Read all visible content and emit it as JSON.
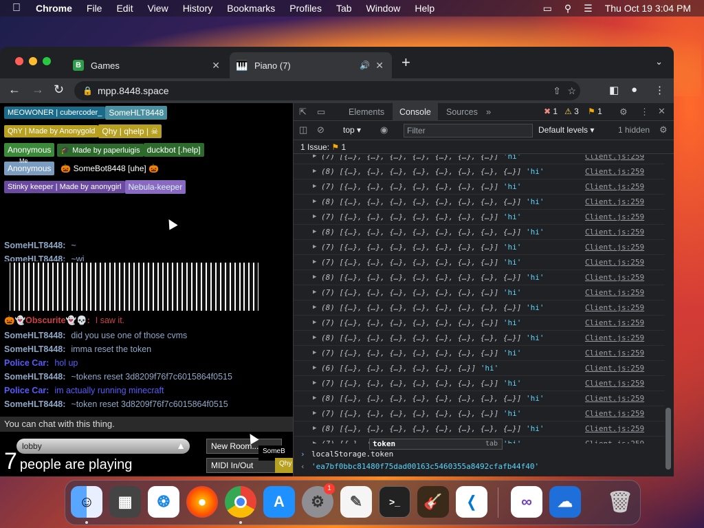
{
  "menubar": {
    "apple": "",
    "app": "Chrome",
    "items": [
      "File",
      "Edit",
      "View",
      "History",
      "Bookmarks",
      "Profiles",
      "Tab",
      "Window",
      "Help"
    ],
    "datetime": "Thu Oct 19  3:04 PM"
  },
  "browser": {
    "tabs": [
      {
        "title": "Games",
        "favicon": "B"
      },
      {
        "title": "Piano (7)",
        "favicon": "piano"
      }
    ],
    "url": "mpp.8448.space"
  },
  "page": {
    "users": [
      {
        "tag": "MEOWONER | cubercoder_",
        "name": "SomeHLT8448"
      },
      {
        "tag": "QhY | Made by Anonygold",
        "name": "Qhy | qhelp | ☠"
      },
      {
        "tag": "Anonymous",
        "name": "🎓 Made by paperluigis",
        "name2": "duckbot [.help]"
      },
      {
        "tag": "Anonymous",
        "me": "Me",
        "name": "🎃 SomeBot8448 [uhe] 🎃"
      },
      {
        "tag": "Stinky keeper | Made by anonygirl",
        "name": "Nebula-keeper"
      }
    ],
    "chat": [
      {
        "who": "SomeHLT8448:",
        "msg": "~"
      },
      {
        "who": "SomeHLT8448:",
        "msg": "~wi"
      },
      {
        "who": "🎃👻Obscurite👻💀:",
        "msg": "I saw it."
      },
      {
        "who": "SomeHLT8448:",
        "msg": "did you use one of those cvms"
      },
      {
        "who": "SomeHLT8448:",
        "msg": "imma reset the token"
      },
      {
        "who": "Police Car:",
        "msg": "hol up"
      },
      {
        "who": "SomeHLT8448:",
        "msg": "~tokens reset 3d8209f76f7c6015864f0515"
      },
      {
        "who": "Police Car:",
        "msg": "im actually running minecraft"
      },
      {
        "who": "SomeHLT8448:",
        "msg": "~token reset 3d8209f76f7c6015864f0515"
      }
    ],
    "chatbar": "You can chat with this thing.",
    "lobby": "lobby",
    "players_count": "7",
    "players_text": "people are playing",
    "new_room": "New Room...",
    "midi": "MIDI In/Out",
    "midi_overlay": "SomeB",
    "qhy_overlay": "Qhy | qhelp"
  },
  "devtools": {
    "tabs": [
      "Elements",
      "Console",
      "Sources"
    ],
    "errors": "1",
    "warnings": "3",
    "info": "1",
    "context": "top",
    "filter_placeholder": "Filter",
    "levels": "Default levels",
    "hidden": "1 hidden",
    "issues": "1 Issue:",
    "issues_count": "1",
    "rows": [
      {
        "n": "(7)",
        "cells": "[{…}, {…}, {…}, {…}, {…}, {…}, {…}]",
        "s": "'hi'"
      },
      {
        "n": "(8)",
        "cells": "[{…}, {…}, {…}, {…}, {…}, {…}, {…}, {…}]",
        "s": "'hi'"
      },
      {
        "n": "(7)",
        "cells": "[{…}, {…}, {…}, {…}, {…}, {…}, {…}]",
        "s": "'hi'"
      },
      {
        "n": "(8)",
        "cells": "[{…}, {…}, {…}, {…}, {…}, {…}, {…}, {…}]",
        "s": "'hi'"
      },
      {
        "n": "(7)",
        "cells": "[{…}, {…}, {…}, {…}, {…}, {…}, {…}]",
        "s": "'hi'"
      },
      {
        "n": "(8)",
        "cells": "[{…}, {…}, {…}, {…}, {…}, {…}, {…}, {…}]",
        "s": "'hi'"
      },
      {
        "n": "(7)",
        "cells": "[{…}, {…}, {…}, {…}, {…}, {…}, {…}]",
        "s": "'hi'"
      },
      {
        "n": "(7)",
        "cells": "[{…}, {…}, {…}, {…}, {…}, {…}, {…}]",
        "s": "'hi'"
      },
      {
        "n": "(8)",
        "cells": "[{…}, {…}, {…}, {…}, {…}, {…}, {…}, {…}]",
        "s": "'hi'"
      },
      {
        "n": "(7)",
        "cells": "[{…}, {…}, {…}, {…}, {…}, {…}, {…}]",
        "s": "'hi'"
      },
      {
        "n": "(8)",
        "cells": "[{…}, {…}, {…}, {…}, {…}, {…}, {…}, {…}]",
        "s": "'hi'"
      },
      {
        "n": "(7)",
        "cells": "[{…}, {…}, {…}, {…}, {…}, {…}, {…}]",
        "s": "'hi'"
      },
      {
        "n": "(8)",
        "cells": "[{…}, {…}, {…}, {…}, {…}, {…}, {…}, {…}]",
        "s": "'hi'"
      },
      {
        "n": "(7)",
        "cells": "[{…}, {…}, {…}, {…}, {…}, {…}, {…}]",
        "s": "'hi'"
      },
      {
        "n": "(6)",
        "cells": "[{…}, {…}, {…}, {…}, {…}, {…}]",
        "s": "'hi'"
      },
      {
        "n": "(7)",
        "cells": "[{…}, {…}, {…}, {…}, {…}, {…}, {…}]",
        "s": "'hi'"
      },
      {
        "n": "(8)",
        "cells": "[{…}, {…}, {…}, {…}, {…}, {…}, {…}, {…}]",
        "s": "'hi'"
      },
      {
        "n": "(7)",
        "cells": "[{…}, {…}, {…}, {…}, {…}, {…}, {…}]",
        "s": "'hi'"
      },
      {
        "n": "(8)",
        "cells": "[{…}, {…}, {…}, {…}, {…}, {…}, {…}, {…}]",
        "s": "'hi'"
      },
      {
        "n": "(7)",
        "cells": "[{…}, {…}, {…}, {…}, {…}, {…}, {…}]",
        "s": "'hi'"
      }
    ],
    "source": "Client.js:259",
    "autocomplete": "token",
    "autocomplete_hint": "tab",
    "prompt": "localStorage.token",
    "result": "'ea7bf0bbc81480f75dad00163c5460355a8492cfafb44f40'"
  },
  "colors": {
    "accent": "#8ab4f8",
    "string": "#5cd5fb",
    "police": "#5a5aff",
    "user": "#8fa8c8"
  }
}
